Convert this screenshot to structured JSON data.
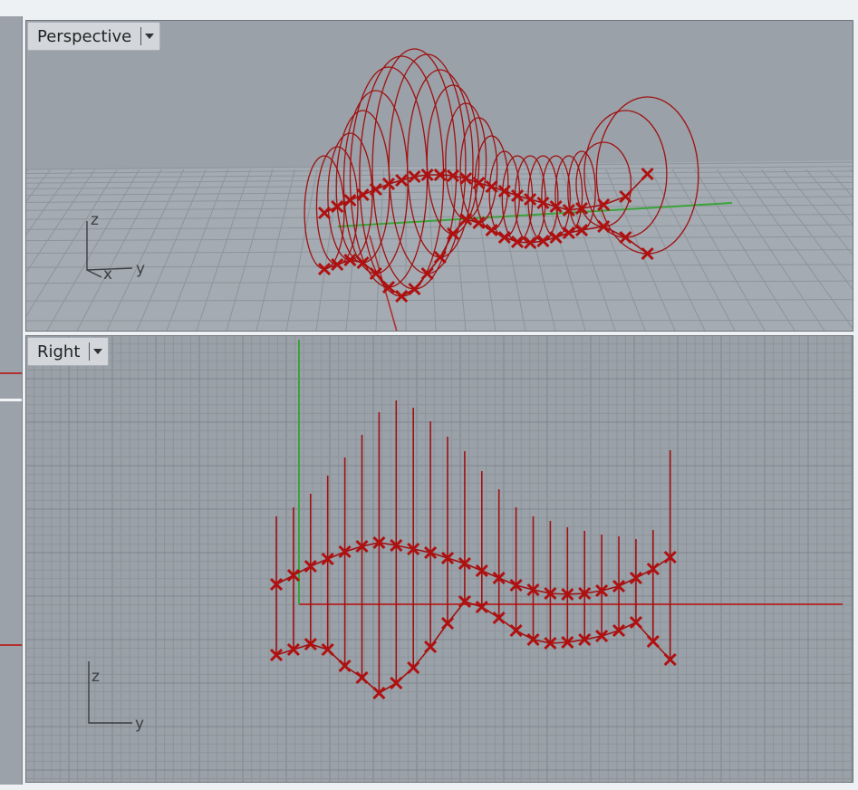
{
  "viewports": [
    {
      "id": "perspective",
      "title": "Perspective",
      "view_menu_icon": "caret-down-icon"
    },
    {
      "id": "right",
      "title": "Right",
      "view_menu_icon": "caret-down-icon"
    }
  ],
  "perspective_axis": {
    "z": "z",
    "x": "x",
    "y": "y"
  },
  "right_axis": {
    "z": "z",
    "y": "y"
  },
  "colors": {
    "viewport_bg": "#9aa1a8",
    "grid_minor": "#8d949b",
    "grid_major": "#7e858c",
    "curve": "#a01010",
    "point_marker": "#b01010",
    "axis_x": "#b23030",
    "axis_y": "#3aa33a",
    "title_bg": "#d3d7db"
  }
}
